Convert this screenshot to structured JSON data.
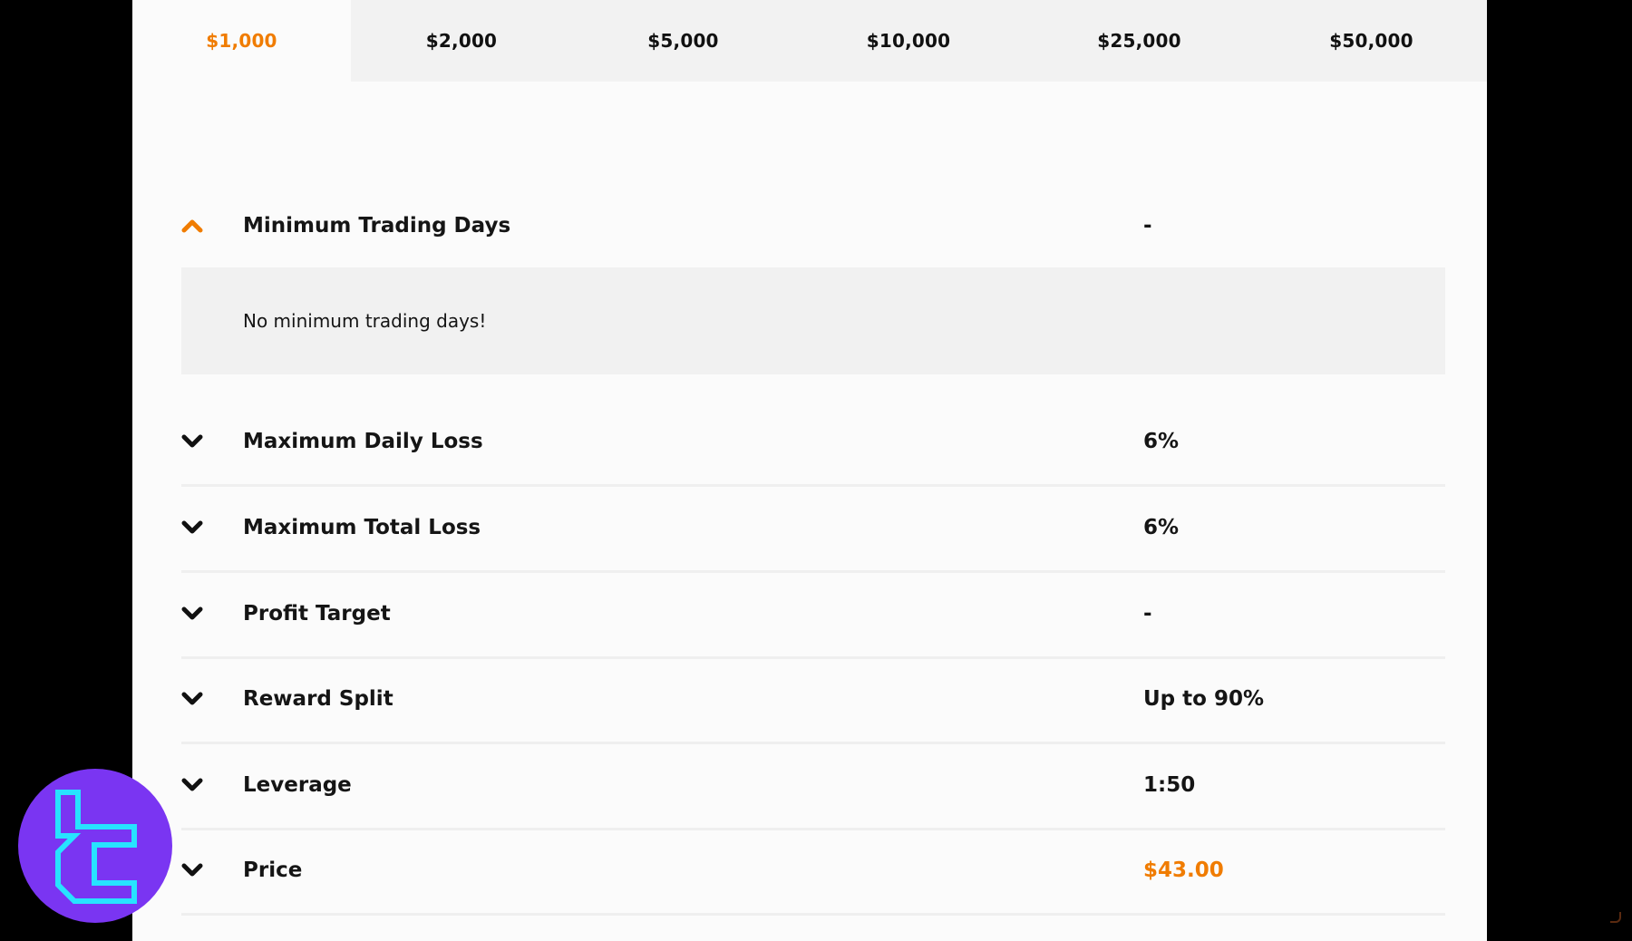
{
  "tabs": [
    {
      "label": "$1,000",
      "active": true
    },
    {
      "label": "$2,000",
      "active": false
    },
    {
      "label": "$5,000",
      "active": false
    },
    {
      "label": "$10,000",
      "active": false
    },
    {
      "label": "$25,000",
      "active": false
    },
    {
      "label": "$50,000",
      "active": false
    }
  ],
  "rules": [
    {
      "label": "Minimum Trading Days",
      "value": "-",
      "expanded": true,
      "detail": "No minimum trading days!",
      "icon": "chevron-up-icon"
    },
    {
      "label": "Maximum Daily Loss",
      "value": "6%",
      "expanded": false,
      "icon": "chevron-down-icon"
    },
    {
      "label": "Maximum Total Loss",
      "value": "6%",
      "expanded": false,
      "icon": "chevron-down-icon"
    },
    {
      "label": "Profit Target",
      "value": "-",
      "expanded": false,
      "icon": "chevron-down-icon"
    },
    {
      "label": "Reward Split",
      "value": "Up to 90%",
      "expanded": false,
      "icon": "chevron-down-icon"
    },
    {
      "label": "Leverage",
      "value": "1:50",
      "expanded": false,
      "icon": "chevron-down-icon"
    },
    {
      "label": "Price",
      "value": "$43.00",
      "expanded": false,
      "icon": "chevron-down-icon",
      "accent": true
    }
  ],
  "colors": {
    "accent": "#f07c00",
    "text": "#151515",
    "tab_bg": "#f2f2f2",
    "card_bg": "#fbfbfb",
    "logo_bg": "#7a35f2",
    "logo_stroke": "#27e3ff"
  },
  "logo": {
    "icon": "brand-logo-icon"
  }
}
